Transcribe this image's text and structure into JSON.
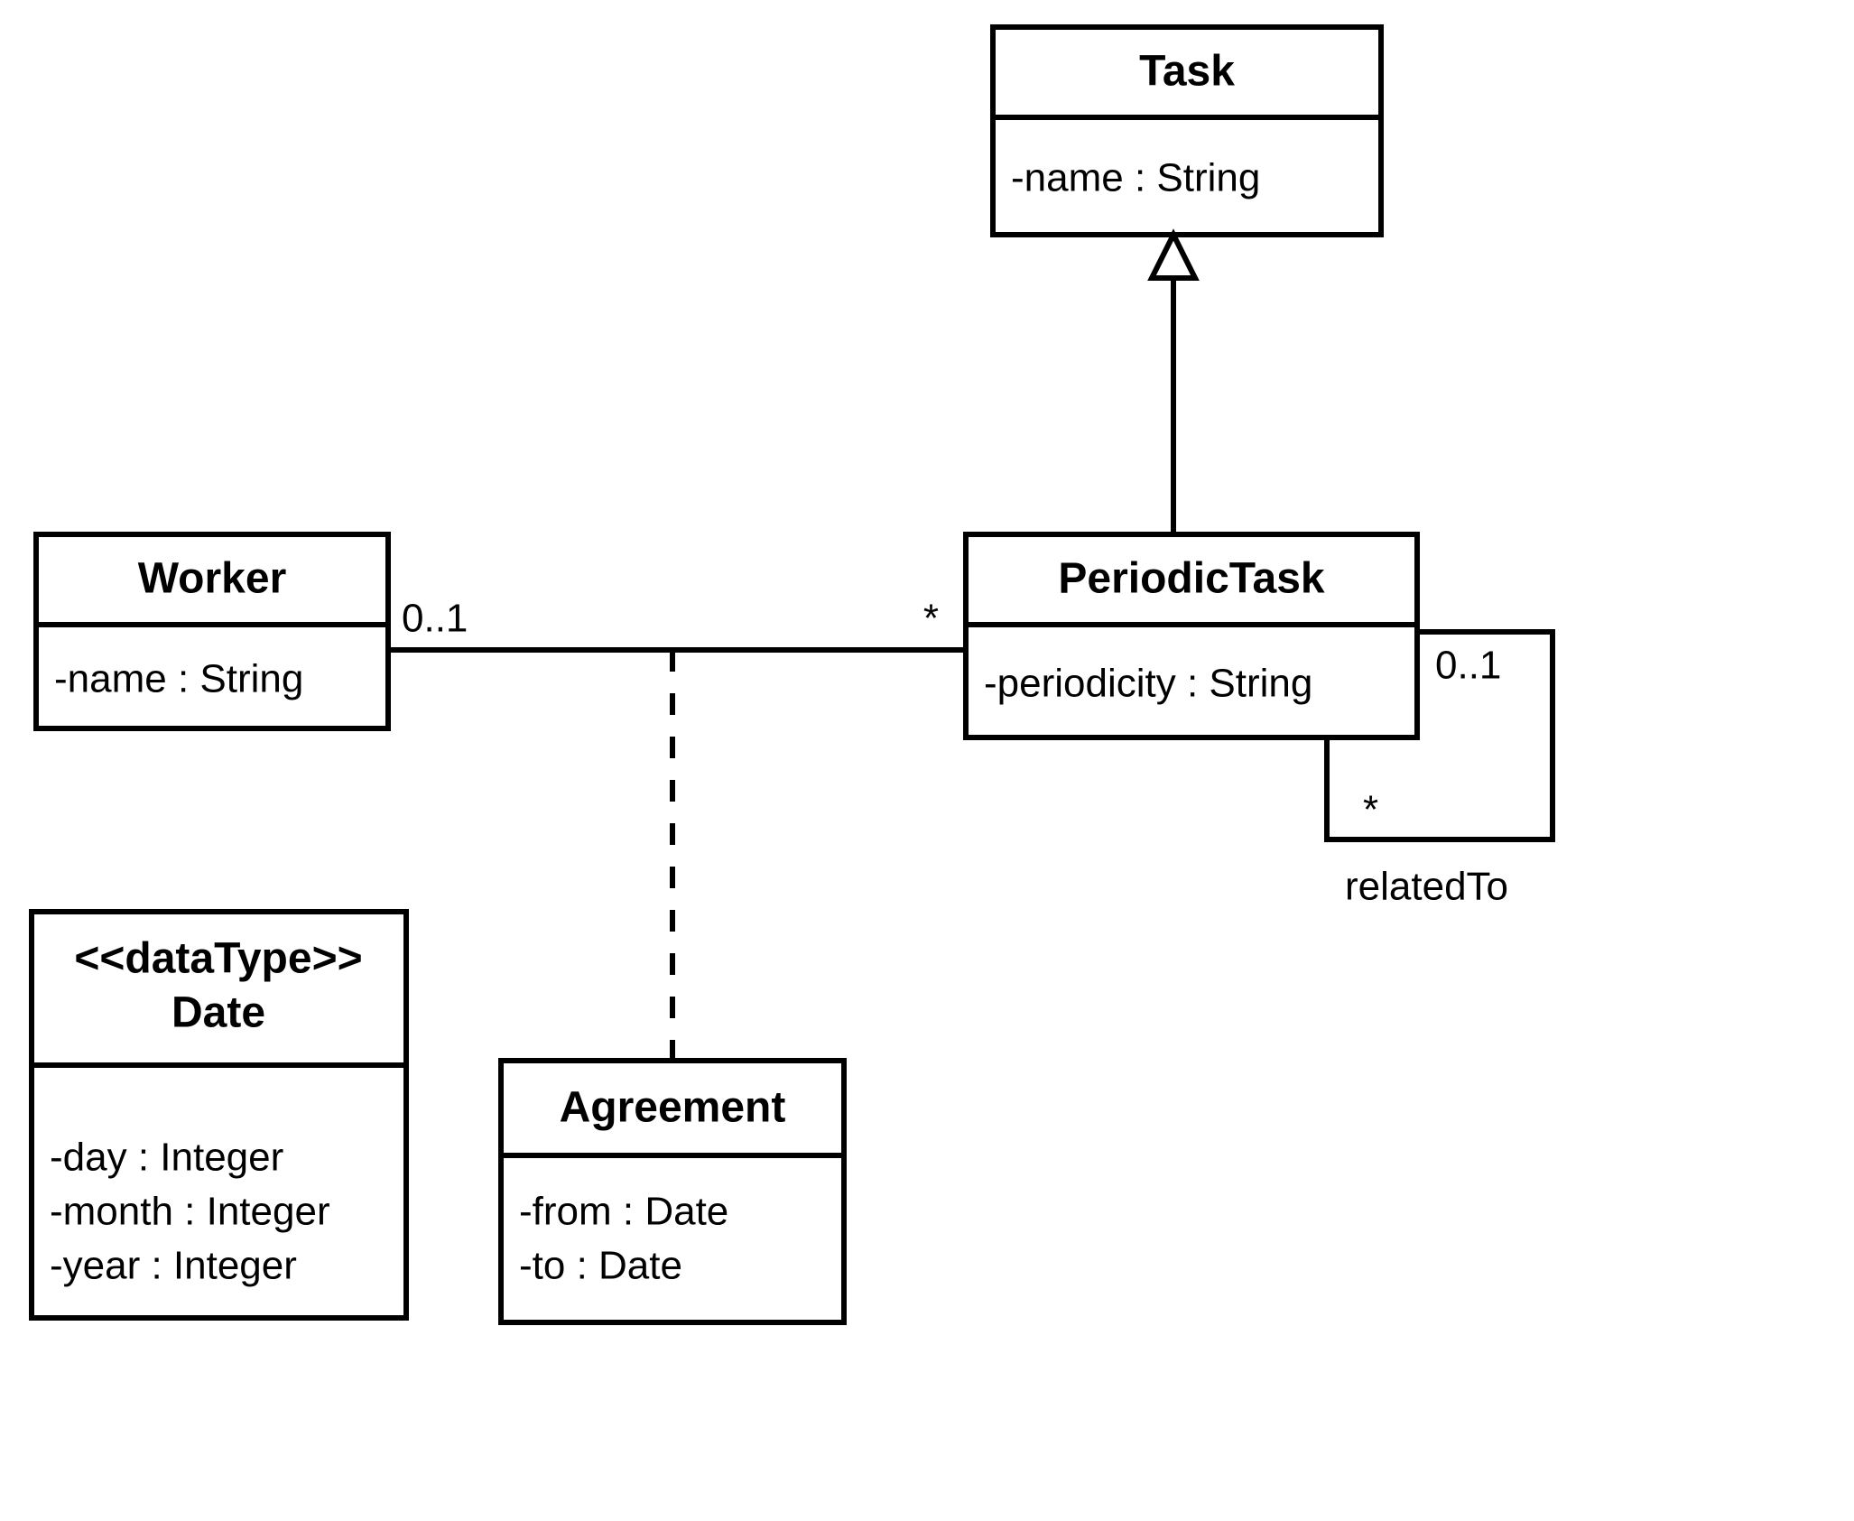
{
  "classes": {
    "task": {
      "name": "Task",
      "attributes": [
        "-name : String"
      ]
    },
    "worker": {
      "name": "Worker",
      "attributes": [
        "-name : String"
      ]
    },
    "periodicTask": {
      "name": "PeriodicTask",
      "attributes": [
        "-periodicity : String"
      ]
    },
    "date": {
      "stereotype": "<<dataType>>",
      "name": "Date",
      "attributes": [
        "-day : Integer",
        "-month : Integer",
        "-year : Integer"
      ]
    },
    "agreement": {
      "name": "Agreement",
      "attributes": [
        "-from : Date",
        "-to : Date"
      ]
    }
  },
  "associations": {
    "workerPeriodic": {
      "leftMult": "0..1",
      "rightMult": "*"
    },
    "selfRelated": {
      "topMult": "0..1",
      "bottomMult": "*",
      "name": "relatedTo"
    }
  },
  "relationships": [
    {
      "type": "generalization",
      "child": "PeriodicTask",
      "parent": "Task"
    },
    {
      "type": "association",
      "ends": [
        "Worker",
        "PeriodicTask"
      ],
      "multiplicities": [
        "0..1",
        "*"
      ],
      "associationClass": "Agreement"
    },
    {
      "type": "association",
      "ends": [
        "PeriodicTask",
        "PeriodicTask"
      ],
      "multiplicities": [
        "0..1",
        "*"
      ],
      "name": "relatedTo"
    }
  ]
}
